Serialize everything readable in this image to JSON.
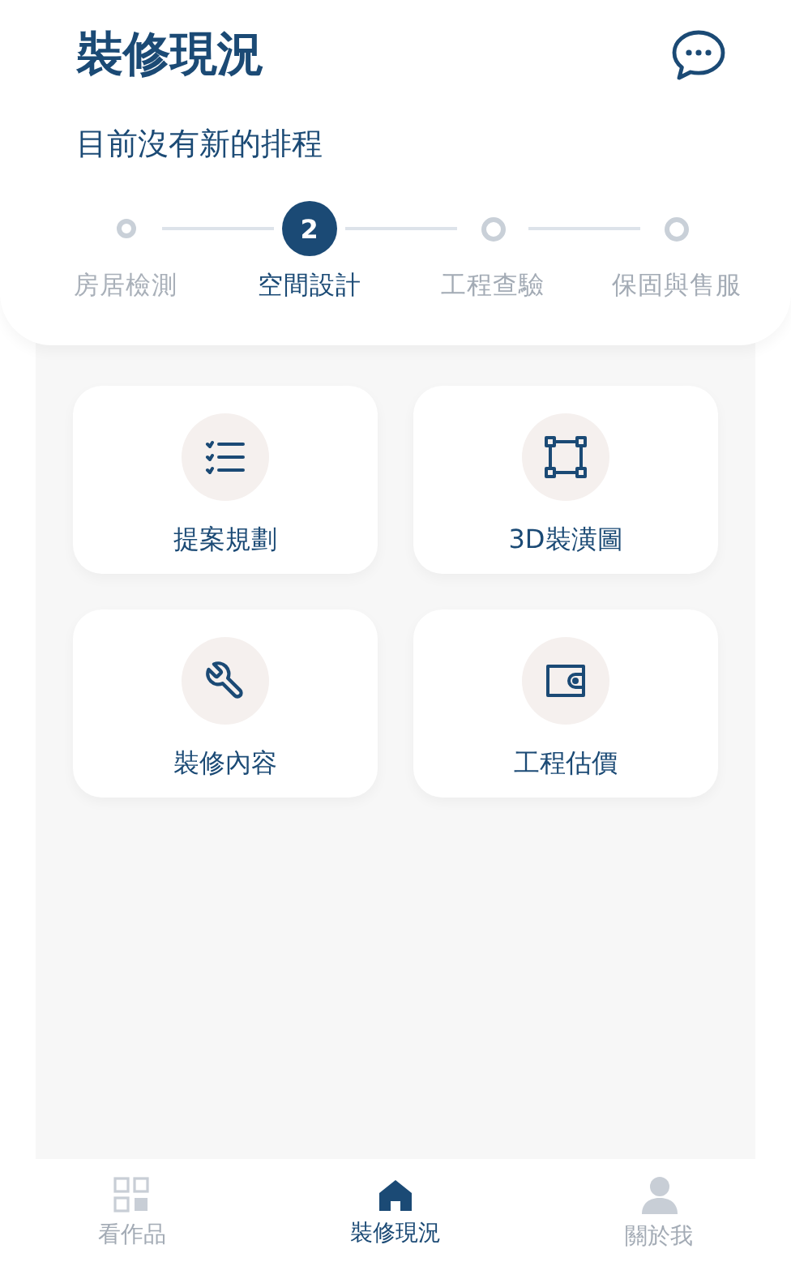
{
  "header": {
    "title": "裝修現況",
    "subtitle": "目前沒有新的排程"
  },
  "steps": [
    {
      "label": "房居檢測",
      "kind": "done"
    },
    {
      "label": "空間設計",
      "kind": "current",
      "number": "2"
    },
    {
      "label": "工程查驗",
      "kind": "todo"
    },
    {
      "label": "保固與售服",
      "kind": "todo"
    }
  ],
  "cards": [
    {
      "label": "提案規劃",
      "kind": "checklist"
    },
    {
      "label": "3D裝潢圖",
      "kind": "frame"
    },
    {
      "label": "裝修內容",
      "kind": "wrench"
    },
    {
      "label": "工程估價",
      "kind": "wallet"
    }
  ],
  "tabs": [
    {
      "label": "看作品",
      "kind": "grid",
      "selected": false
    },
    {
      "label": "裝修現況",
      "kind": "home",
      "selected": true
    },
    {
      "label": "關於我",
      "kind": "person",
      "selected": false
    }
  ]
}
